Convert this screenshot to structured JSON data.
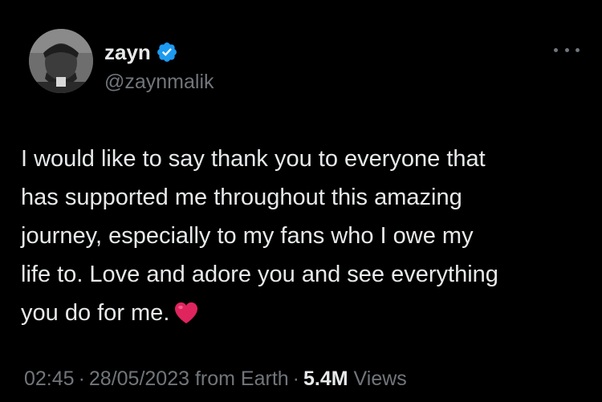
{
  "author": {
    "display_name": "zayn",
    "handle": "@zaynmalik",
    "verified": true,
    "verified_color": "#1d9bf0",
    "avatar_icon": "profile-photo"
  },
  "tweet": {
    "lines": [
      "I would like to say thank you to everyone that",
      "has supported me throughout this amazing",
      "journey, especially to my fans who I owe my",
      "life to. Love and adore you and see everything",
      "you do for me."
    ],
    "emoji": "heart-emoji",
    "emoji_color": "#e0245e"
  },
  "meta": {
    "time": "02:45",
    "separator": "·",
    "date": "28/05/2023",
    "source": "from Earth",
    "views_count": "5.4M",
    "views_label": "Views"
  },
  "colors": {
    "background": "#000000",
    "text_primary": "#e7e9ea",
    "text_secondary": "#71767b"
  }
}
